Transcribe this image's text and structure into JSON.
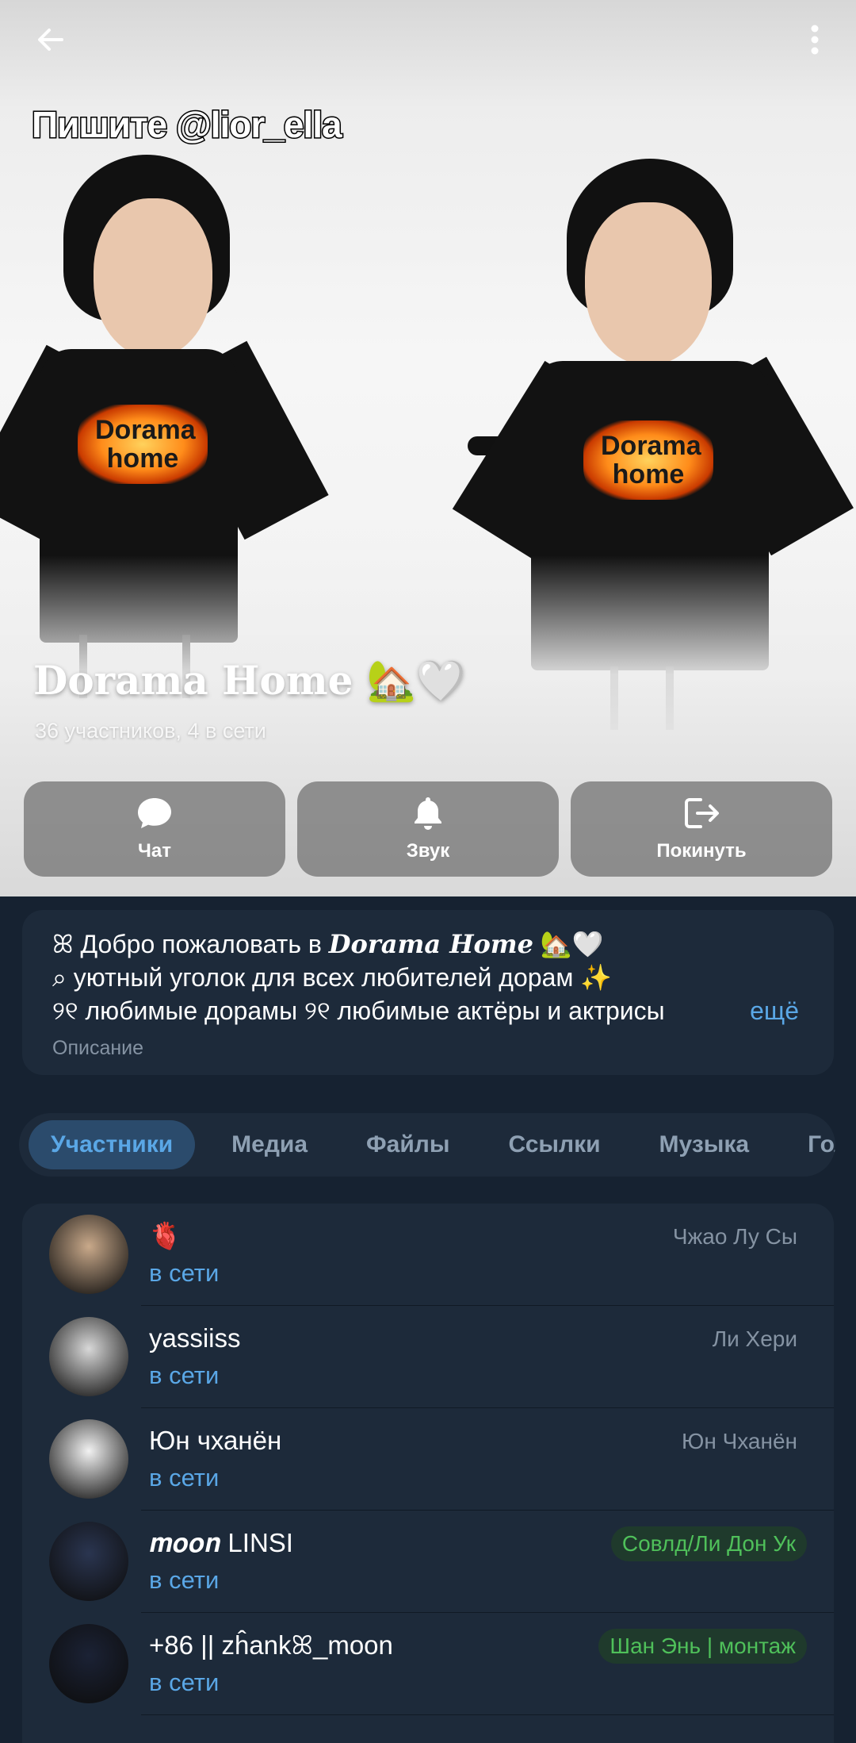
{
  "header": {
    "caption": "Пишите @lior_ella",
    "shirt_text": "Dorama home",
    "title": "Dorama Home 🏡🤍",
    "subtitle": "36 участников, 4 в сети",
    "back_icon": "arrow-left-icon",
    "more_icon": "vertical-dots-icon"
  },
  "actions": [
    {
      "label": "Чат",
      "icon": "chat-bubble-icon"
    },
    {
      "label": "Звук",
      "icon": "bell-icon"
    },
    {
      "label": "Покинуть",
      "icon": "leave-icon"
    }
  ],
  "description": {
    "line1_prefix": "ꕤ Добро пожаловать в ",
    "line1_em": "Dorama Home",
    "line1_suffix": " 🏡🤍",
    "line2": "⌕ уютный уголок для всех любителей дорам ✨",
    "line3": "୨୧ любимые дорамы ୨୧ любимые актёры и актрисы",
    "more": "ещё",
    "label": "Описание"
  },
  "tabs": [
    "Участники",
    "Медиа",
    "Файлы",
    "Ссылки",
    "Музыка",
    "Голосовые"
  ],
  "members": [
    {
      "name": "🫀",
      "status": "в сети",
      "role": "Чжао Лу Сы",
      "tag": false,
      "avatar_color": "#c9a98a"
    },
    {
      "name": "yassiiss",
      "status": "в сети",
      "role": "Ли Хери",
      "tag": false,
      "avatar_color": "#d8d8d8"
    },
    {
      "name": "Юн чханён",
      "status": "в сети",
      "role": "Юн Чханён",
      "tag": false,
      "avatar_color": "#f2f2f2"
    },
    {
      "name": "𝒎𝒐𝒐𝒏 LINSI",
      "status": "в сети",
      "role": "Совлд/Ли Дон Ук",
      "tag": true,
      "avatar_color": "#2a3550"
    },
    {
      "name": "+86 || zĥankꕤ_moon",
      "status": "в сети",
      "role": "Шан Энь | монтаж",
      "tag": true,
      "avatar_color": "#1b2235"
    }
  ]
}
